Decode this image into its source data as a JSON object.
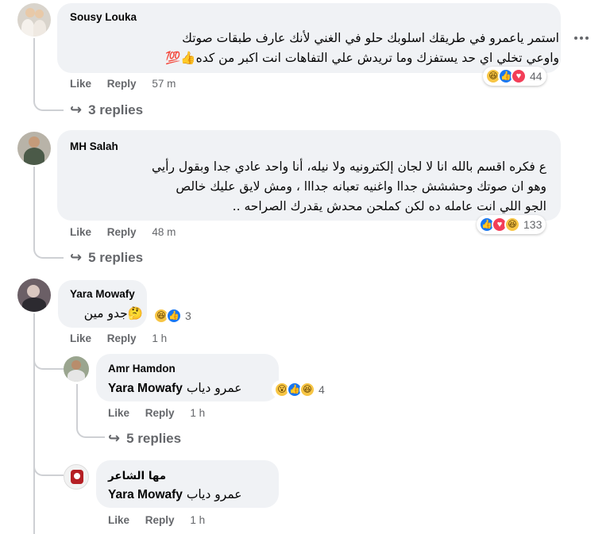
{
  "comments": [
    {
      "author": "Sousy Louka",
      "lines": [
        "استمر ياعمرو في طريقك اسلوبك حلو في الغني لأنك عارف طبقات صوتك",
        "واوعي تخلي اي حد يستفزك وما تريدش علي التفاهات انت اكبر من كده👍💯"
      ],
      "like_label": "Like",
      "reply_label": "Reply",
      "time": "57 m",
      "reactions": [
        "haha",
        "like",
        "love"
      ],
      "reaction_count": "44",
      "replies_label": "3 replies"
    },
    {
      "author": "MH Salah",
      "lines": [
        "ع فكره اقسم بالله انا لا لجان إلكترونيه ولا نيله، أنا واحد عادي جدا وبقول رأيي",
        "وهو ان صوتك وحششش جداا واغنيه تعبانه جدااا ، ومش لايق عليك خالص",
        "الجو اللي انت عامله ده لكن كملحن محدش يقدرك الصراحه .."
      ],
      "like_label": "Like",
      "reply_label": "Reply",
      "time": "48 m",
      "reactions": [
        "like",
        "love",
        "haha"
      ],
      "reaction_count": "133",
      "replies_label": "5 replies"
    },
    {
      "author": "Yara Mowafy",
      "lines": [
        "🤔جدو مين"
      ],
      "like_label": "Like",
      "reply_label": "Reply",
      "time": "1 h",
      "reactions": [
        "haha",
        "like"
      ],
      "reaction_count": "3",
      "replies": [
        {
          "author": "Amr Hamdon",
          "mention": "Yara Mowafy",
          "text": "عمرو دياب",
          "like_label": "Like",
          "reply_label": "Reply",
          "time": "1 h",
          "reactions": [
            "wow",
            "like",
            "haha"
          ],
          "reaction_count": "4",
          "replies_label": "5 replies"
        },
        {
          "author": "مها الشاعر",
          "mention": "Yara Mowafy",
          "text": "عمرو دياب",
          "like_label": "Like",
          "reply_label": "Reply",
          "time": "1 h"
        }
      ]
    }
  ],
  "reaction_glyphs": {
    "haha": "😆",
    "like": "👍",
    "love": "♥",
    "wow": "😮"
  },
  "colors": {
    "bubble": "#f0f2f5",
    "meta": "#65676b",
    "like": "#1877f2",
    "love": "#f33e58",
    "haha": "#f7c544"
  }
}
